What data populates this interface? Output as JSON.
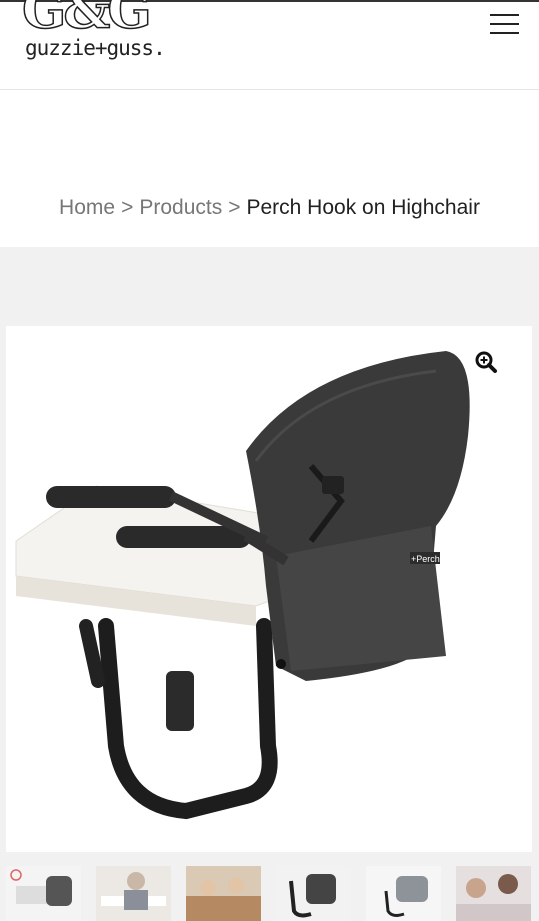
{
  "brand": {
    "logo_mark": "G&G",
    "logo_word": "guzzie+guss."
  },
  "header": {
    "menu_icon": "hamburger-menu-icon"
  },
  "breadcrumb": {
    "home": "Home",
    "separator": ">",
    "products": "Products",
    "current": "Perch Hook on Highchair"
  },
  "product": {
    "chair_label": "+Perch",
    "zoom_icon": "zoom-in-icon"
  },
  "gallery": {
    "thumbnails": [
      {
        "name": "thumbnail-1"
      },
      {
        "name": "thumbnail-2"
      },
      {
        "name": "thumbnail-3"
      },
      {
        "name": "thumbnail-4"
      },
      {
        "name": "thumbnail-5"
      },
      {
        "name": "thumbnail-6"
      }
    ]
  }
}
